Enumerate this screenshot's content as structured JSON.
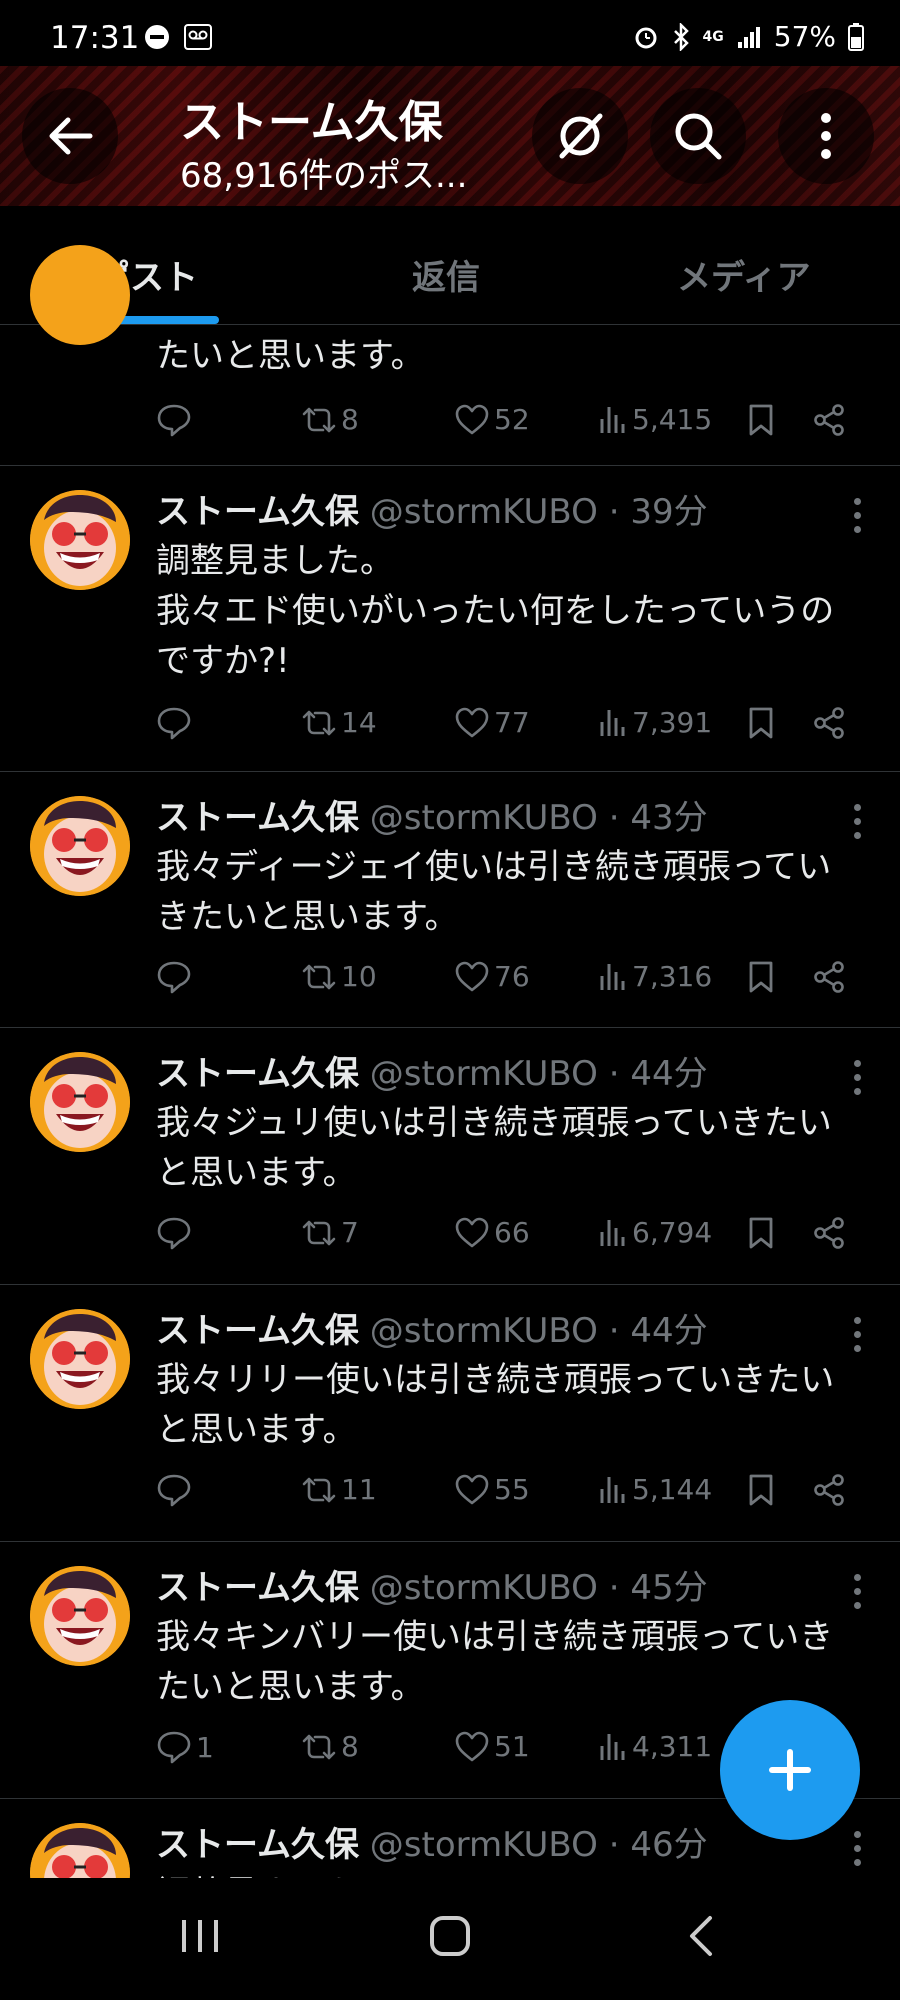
{
  "status": {
    "time": "17:31",
    "network": "4G",
    "battery": "57%"
  },
  "header": {
    "title": "ストーム久保",
    "subtitle": "68,916件のポス..."
  },
  "tabs": [
    "ポスト",
    "返信",
    "メディア"
  ],
  "posts": [
    {
      "partial": true,
      "text": "たいと思います。",
      "replies": "",
      "reposts": "8",
      "likes": "52",
      "views": "5,415"
    },
    {
      "name": "ストーム久保",
      "meta": "@stormKUBO · 39分",
      "text": "調整見ました。\n我々エド使いがいったい何をしたっていうのですか?!",
      "replies": "",
      "reposts": "14",
      "likes": "77",
      "views": "7,391"
    },
    {
      "name": "ストーム久保",
      "meta": "@stormKUBO · 43分",
      "text": "我々ディージェイ使いは引き続き頑張っていきたいと思います。",
      "replies": "",
      "reposts": "10",
      "likes": "76",
      "views": "7,316"
    },
    {
      "name": "ストーム久保",
      "meta": "@stormKUBO · 44分",
      "text": "我々ジュリ使いは引き続き頑張っていきたいと思います。",
      "replies": "",
      "reposts": "7",
      "likes": "66",
      "views": "6,794"
    },
    {
      "name": "ストーム久保",
      "meta": "@stormKUBO · 44分",
      "text": "我々リリー使いは引き続き頑張っていきたいと思います。",
      "replies": "",
      "reposts": "11",
      "likes": "55",
      "views": "5,144"
    },
    {
      "name": "ストーム久保",
      "meta": "@stormKUBO · 45分",
      "text": "我々キンバリー使いは引き続き頑張っていきたいと思います。",
      "replies": "1",
      "reposts": "8",
      "likes": "51",
      "views": "4,311"
    },
    {
      "name": "ストーム久保",
      "meta": "@stormKUBO · 46分",
      "text": "調整見ました。",
      "clipped": true
    }
  ],
  "colors": {
    "accent": "#1d9bf0",
    "background": "#000000",
    "text": "#e7e9ea",
    "muted": "#71767b"
  },
  "icons": [
    "back-arrow-icon",
    "no-signal-icon",
    "search-icon",
    "more-vertical-icon",
    "reply-icon",
    "repost-icon",
    "like-icon",
    "views-icon",
    "bookmark-icon",
    "share-icon",
    "compose-plus-icon"
  ]
}
